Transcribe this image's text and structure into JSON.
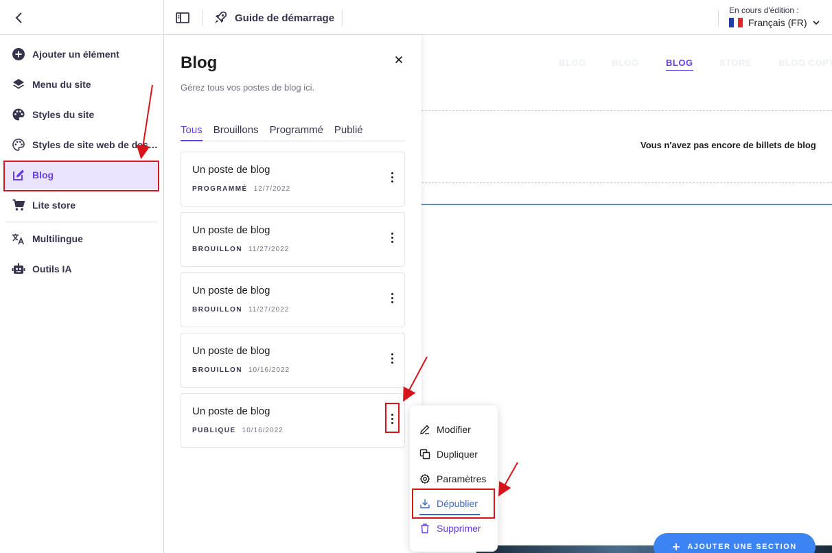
{
  "topbar": {
    "guide_label": "Guide de démarrage",
    "editing_label": "En cours d'édition :",
    "language": "Français (FR)"
  },
  "sidebar": {
    "items": [
      {
        "label": "Ajouter un élément",
        "icon": "plus-circle-icon"
      },
      {
        "label": "Menu du site",
        "icon": "layers-icon"
      },
      {
        "label": "Styles du site",
        "icon": "palette-icon"
      },
      {
        "label": "Styles de site web de design",
        "icon": "palette-outline-icon"
      },
      {
        "label": "Blog",
        "icon": "edit-icon"
      },
      {
        "label": "Lite store",
        "icon": "cart-icon"
      },
      {
        "label": "Multilingue",
        "icon": "translate-icon"
      },
      {
        "label": "Outils IA",
        "icon": "robot-icon"
      }
    ]
  },
  "panel": {
    "title": "Blog",
    "subtitle": "Gérez tous vos postes de blog ici.",
    "tabs": [
      "Tous",
      "Brouillons",
      "Programmé",
      "Publié"
    ],
    "posts": [
      {
        "title": "Un poste de blog",
        "status": "PROGRAMMÉ",
        "date": "12/7/2022"
      },
      {
        "title": "Un poste de blog",
        "status": "BROUILLON",
        "date": "11/27/2022"
      },
      {
        "title": "Un poste de blog",
        "status": "BROUILLON",
        "date": "11/27/2022"
      },
      {
        "title": "Un poste de blog",
        "status": "BROUILLON",
        "date": "10/16/2022"
      },
      {
        "title": "Un poste de blog",
        "status": "PUBLIQUE",
        "date": "10/16/2022"
      }
    ]
  },
  "canvas": {
    "nav": [
      "BLOG",
      "BLOG",
      "BLOG",
      "STORE",
      "BLOG COPY"
    ],
    "empty_message": "Vous n'avez pas encore de billets de blog",
    "add_section_label": "AJOUTER UNE SECTION"
  },
  "menu": {
    "items": [
      {
        "label": "Modifier",
        "icon": "pencil-icon"
      },
      {
        "label": "Dupliquer",
        "icon": "duplicate-icon"
      },
      {
        "label": "Paramètres",
        "icon": "gear-icon"
      },
      {
        "label": "Dépublier",
        "icon": "download-icon"
      },
      {
        "label": "Supprimer",
        "icon": "trash-icon"
      }
    ]
  },
  "colors": {
    "accent": "#673de6",
    "annotation": "#d7141a",
    "add_button": "#3c84f2"
  }
}
